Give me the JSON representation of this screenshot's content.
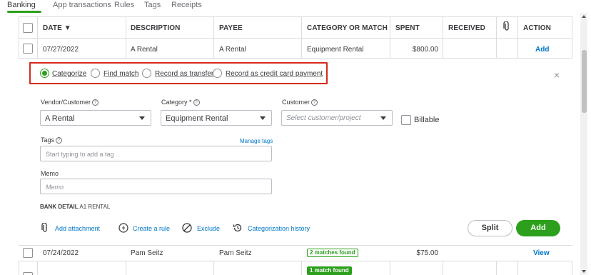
{
  "tabs": [
    {
      "label": "Banking"
    },
    {
      "label": "App transactions"
    },
    {
      "label": "Rules"
    },
    {
      "label": "Tags"
    },
    {
      "label": "Receipts"
    }
  ],
  "table": {
    "headers": {
      "date": "DATE ▼",
      "description": "DESCRIPTION",
      "payee": "PAYEE",
      "category": "CATEGORY OR MATCH",
      "spent": "SPENT",
      "received": "RECEIVED",
      "action": "ACTION"
    },
    "rows": [
      {
        "date": "07/27/2022",
        "description": "A Rental",
        "payee": "A Rental",
        "category": "Equipment Rental",
        "spent": "$800.00",
        "received": "",
        "action": "Add"
      },
      {
        "date": "07/24/2022",
        "description": "Pam Seitz",
        "payee": "Pam Seitz",
        "category": "2 matches found",
        "spent": "$75.00",
        "received": "",
        "action": "View"
      },
      {
        "date": "",
        "description": "",
        "payee": "",
        "category": "1 match found",
        "spent": "",
        "received": "",
        "action": ""
      }
    ]
  },
  "panel": {
    "radios": [
      {
        "label": "Categorize",
        "selected": true
      },
      {
        "label": "Find match",
        "selected": false
      },
      {
        "label": "Record as transfer",
        "selected": false
      },
      {
        "label": "Record as credit card payment",
        "selected": false
      }
    ],
    "close_icon": "×",
    "vendor": {
      "label": "Vendor/Customer",
      "value": "A Rental"
    },
    "category": {
      "label": "Category *",
      "value": "Equipment Rental"
    },
    "customer": {
      "label": "Customer",
      "placeholder": "Select customer/project"
    },
    "billable": {
      "label": "Billable",
      "checked": false
    },
    "tags": {
      "label": "Tags",
      "manage": "Manage tags",
      "placeholder": "Start typing to add a tag"
    },
    "memo": {
      "label": "Memo",
      "placeholder": "Memo"
    },
    "bank_detail": {
      "label": "BANK DETAIL",
      "value": "A1 RENTAL"
    },
    "actions": {
      "attachment": "Add attachment",
      "rule": "Create a rule",
      "exclude": "Exclude",
      "history": "Categorization history"
    },
    "split_button": "Split",
    "add_button": "Add"
  },
  "colors": {
    "accent": "#2ca01c",
    "link": "#0077c5",
    "highlight": "#d52b1e"
  }
}
